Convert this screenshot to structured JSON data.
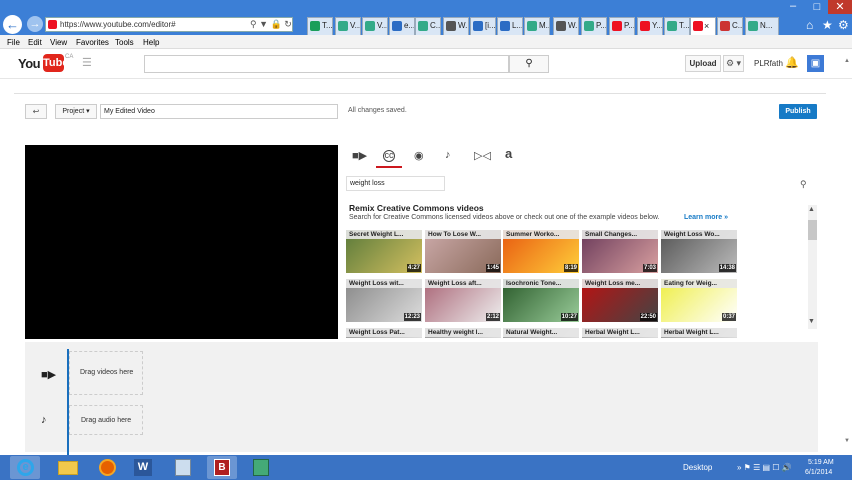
{
  "browser": {
    "url": "https://www.youtube.com/editor#",
    "tabs": [
      "T...",
      "V...",
      "V...",
      "e...",
      "C...",
      "W...",
      "[i...",
      "L...",
      "M...",
      "W...",
      "P...",
      "P...",
      "Y...",
      "T...",
      "",
      "C...",
      "N..."
    ],
    "menu": [
      "File",
      "Edit",
      "View",
      "Favorites",
      "Tools",
      "Help"
    ]
  },
  "youtube": {
    "logo_you": "You",
    "logo_tube": "Tube",
    "logo_region": "CA",
    "upload_label": "Upload",
    "username": "PLRfath"
  },
  "editor": {
    "project_label": "Project",
    "video_title": "My Edited Video",
    "save_status": "All changes saved.",
    "publish_label": "Publish",
    "search_query": "weight loss",
    "remix_title": "Remix Creative Commons videos",
    "remix_subtitle": "Search for Creative Commons licensed videos above or check out one of the example videos below.",
    "learn_more": "Learn more »",
    "videos": [
      {
        "title": "Secret Weight L...",
        "duration": "4:27"
      },
      {
        "title": "How To Lose W...",
        "duration": "1:45"
      },
      {
        "title": "Summer Worko...",
        "duration": "8:19"
      },
      {
        "title": "Small Changes...",
        "duration": "7:03"
      },
      {
        "title": "Weight Loss Wo...",
        "duration": "14:38"
      },
      {
        "title": "Weight Loss wit...",
        "duration": "12:23"
      },
      {
        "title": "Weight Loss aft...",
        "duration": "2:12"
      },
      {
        "title": "Isochronic Tone...",
        "duration": "10:27"
      },
      {
        "title": "Weight Loss me...",
        "duration": "22:50"
      },
      {
        "title": "Eating for Weig...",
        "duration": "0:37"
      },
      {
        "title": "Weight Loss Pat...",
        "duration": ""
      },
      {
        "title": "Healthy weight l...",
        "duration": ""
      },
      {
        "title": "Natural Weight...",
        "duration": ""
      },
      {
        "title": "Herbal Weight L...",
        "duration": ""
      },
      {
        "title": "Herbal Weight L...",
        "duration": ""
      }
    ],
    "drag_videos": "Drag videos here",
    "drag_audio": "Drag audio here"
  },
  "taskbar": {
    "desktop_label": "Desktop",
    "time": "5:19 AM",
    "date": "6/1/2014"
  },
  "colors": {
    "accent": "#167ac6",
    "youtube_red": "#e1261c",
    "titlebar": "#3c7fd6",
    "taskbar": "#3a73c4"
  }
}
